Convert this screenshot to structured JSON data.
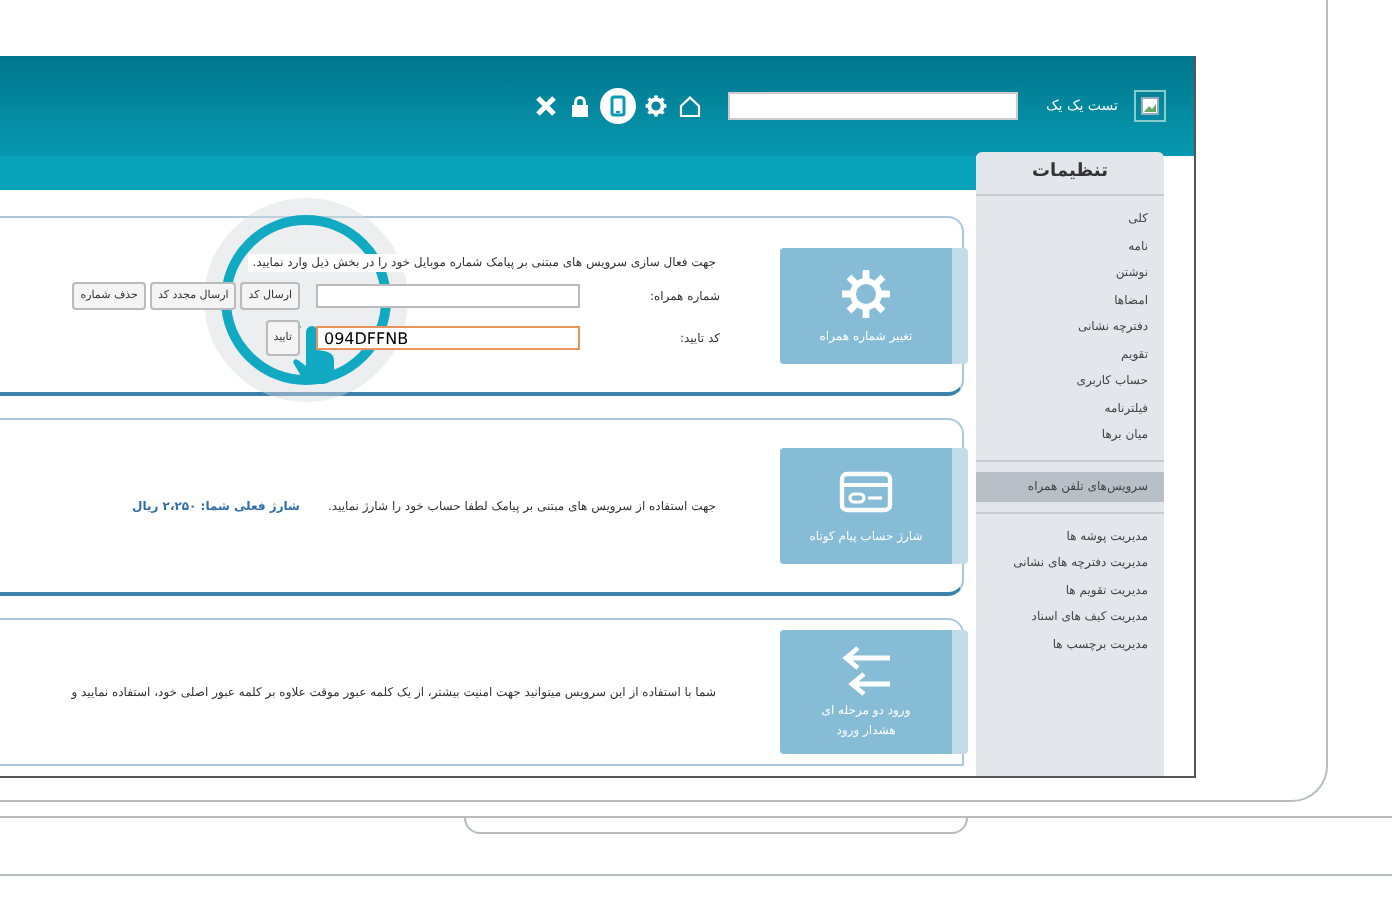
{
  "header": {
    "title": "تست یک یک",
    "toolbar": [
      {
        "kind": "close",
        "selected": false
      },
      {
        "kind": "lock",
        "selected": false
      },
      {
        "kind": "tablet",
        "selected": true
      },
      {
        "kind": "gear",
        "selected": false
      },
      {
        "kind": "home",
        "selected": false
      }
    ]
  },
  "sidebar": {
    "title": "تنظیمات",
    "groups": [
      [
        {
          "label": "کلی",
          "selected": false
        },
        {
          "label": "نامه",
          "selected": false
        },
        {
          "label": "نوشتن",
          "selected": false
        },
        {
          "label": "امضاها",
          "selected": false
        },
        {
          "label": "دفترچه نشانی",
          "selected": false
        },
        {
          "label": "تقویم",
          "selected": false
        },
        {
          "label": "حساب کاربری",
          "selected": false
        },
        {
          "label": "فیلترنامه",
          "selected": false
        },
        {
          "label": "میان برها",
          "selected": false
        }
      ],
      [
        {
          "label": "سرویس‌های تلفن همراه",
          "selected": true
        }
      ],
      [
        {
          "label": "مدیریت پوشه ها",
          "selected": false
        },
        {
          "label": "مدیریت دفترچه های نشانی",
          "selected": false
        },
        {
          "label": "مدیریت تقویم ها",
          "selected": false
        },
        {
          "label": "مدیریت کیف های اسناد",
          "selected": false
        },
        {
          "label": "مدیریت برچسب ها",
          "selected": false
        }
      ]
    ]
  },
  "cards": [
    {
      "kind": "phone",
      "tile": [
        "تغییر شماره همراه"
      ],
      "text": "جهت فعال سازی سرویس های مبتنی بر پیامک شماره موبایل خود را در بخش ذیل وارد نمایید.",
      "phone_label": "شماره همراه:",
      "phone_buttons": [
        "ارسال کد",
        "ارسال مجدد کد",
        "حذف شماره"
      ],
      "code_label": "کد تایید:",
      "code_value": "094DFFNB",
      "code_focused": true,
      "confirm_button": "تایید"
    },
    {
      "kind": "charge",
      "tile": [
        "شارژ حساب پیام کوتاه"
      ],
      "text": "جهت استفاده از سرویس های مبتنی بر پیامک لطفا حساب خود را شارژ نمایید.",
      "balance": "شارژ فعلی شما:  ۲،۲۵۰  ریال"
    },
    {
      "kind": "twofactor",
      "tile": [
        "ورود دو مرحله ای",
        "هشدار ورود"
      ],
      "text": "شما با استفاده از این سرویس میتوانید جهت امنیت بیشتر، از یک کلمه عبور موقت علاوه بر کلمه عبور اصلی خود، استفاده نمایید و"
    }
  ]
}
